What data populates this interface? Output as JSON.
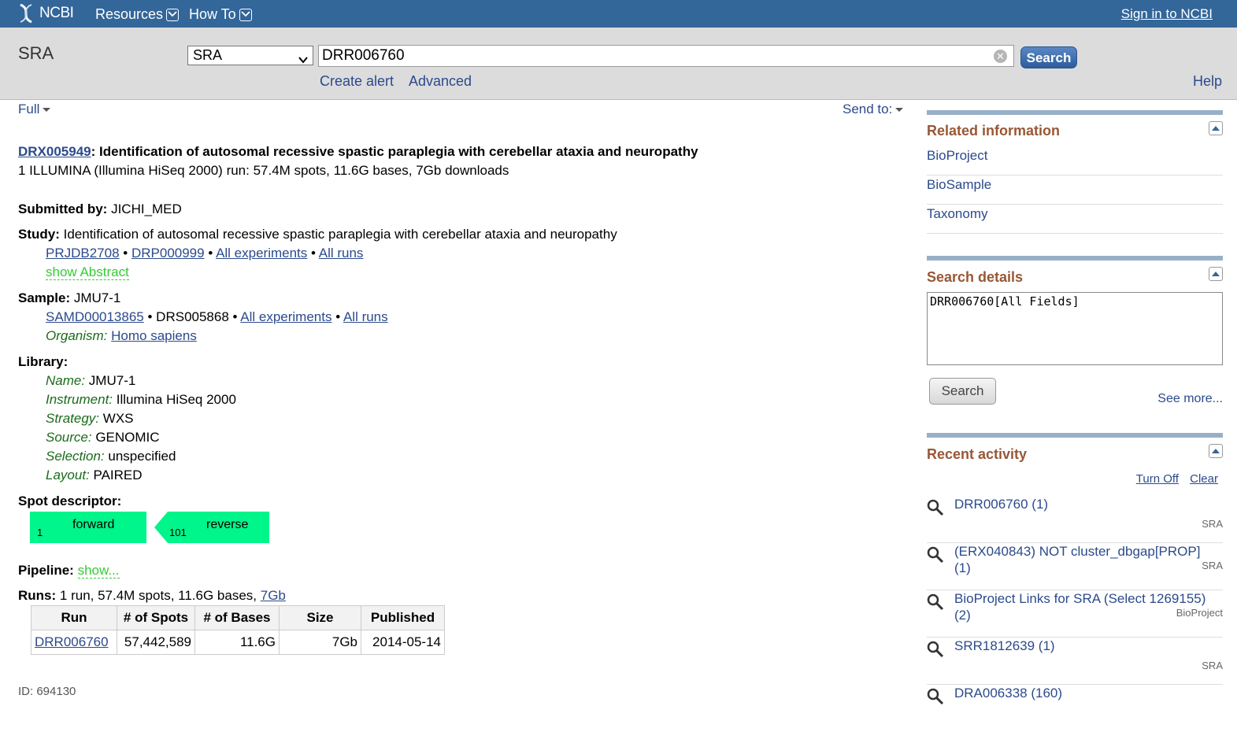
{
  "topbar": {
    "logo": "NCBI",
    "resources": "Resources",
    "howto": "How To",
    "signin": "Sign in to NCBI"
  },
  "search": {
    "db_title": "SRA",
    "db_selected": "SRA",
    "term": "DRR006760",
    "button": "Search",
    "create_alert": "Create alert",
    "advanced": "Advanced",
    "help": "Help"
  },
  "toolbar": {
    "full": "Full",
    "send_to": "Send to:"
  },
  "record": {
    "accession": "DRX005949",
    "title": ": Identification of autosomal recessive spastic paraplegia with cerebellar ataxia and neuropathy",
    "summary": "1 ILLUMINA (Illumina HiSeq 2000) run: 57.4M spots, 11.6G bases, 7Gb downloads",
    "submitted_label": "Submitted by:",
    "submitted_value": " JICHI_MED",
    "study_label": "Study:",
    "study_value": " Identification of autosomal recessive spastic paraplegia with cerebellar ataxia and neuropathy",
    "study_links": [
      "PRJDB2708",
      "DRP000999",
      "All experiments",
      "All runs"
    ],
    "sep": " • ",
    "show_abstract": "show Abstract",
    "sample_label": "Sample:",
    "sample_value": " JMU7-1",
    "sample_link1": "SAMD00013865",
    "sample_mid": "DRS005868",
    "sample_link2": "All experiments",
    "sample_link3": "All runs",
    "organism_label": "Organism:",
    "organism_value": "Homo sapiens",
    "library_label": "Library:",
    "library": [
      {
        "label": "Name:",
        "value": " JMU7-1"
      },
      {
        "label": "Instrument:",
        "value": " Illumina HiSeq 2000"
      },
      {
        "label": "Strategy:",
        "value": " WXS"
      },
      {
        "label": "Source:",
        "value": " GENOMIC"
      },
      {
        "label": "Selection:",
        "value": " unspecified"
      },
      {
        "label": "Layout:",
        "value": " PAIRED"
      }
    ],
    "spot_label": "Spot descriptor:",
    "spot_forward": "forward",
    "spot_forward_pos": "1",
    "spot_reverse": "reverse",
    "spot_reverse_pos": "101",
    "pipeline_label": "Pipeline:",
    "pipeline_link": "show...",
    "runs_label": "Runs:",
    "runs_value": " 1 run, 57.4M spots, 11.6G bases, ",
    "runs_link": "7Gb",
    "table_headers": [
      "Run",
      "# of Spots",
      "# of Bases",
      "Size",
      "Published"
    ],
    "table_row": [
      "DRR006760",
      "57,442,589",
      "11.6G",
      "7Gb",
      "2014-05-14"
    ],
    "id_text": "ID: 694130"
  },
  "sidebar": {
    "related_title": "Related information",
    "related_items": [
      "BioProject",
      "BioSample",
      "Taxonomy"
    ],
    "search_details_title": "Search details",
    "query": "DRR006760[All Fields]",
    "search_button": "Search",
    "see_more": "See more...",
    "recent_title": "Recent activity",
    "turn_off": "Turn Off",
    "clear": "Clear",
    "recent_items": [
      {
        "text": "DRR006760 (1)",
        "db": "SRA"
      },
      {
        "text": "(ERX040843) NOT cluster_dbgap[PROP] (1)",
        "db": "SRA"
      },
      {
        "text": "BioProject Links for SRA (Select 1269155) (2)",
        "db": "BioProject"
      },
      {
        "text": "SRR1812639 (1)",
        "db": "SRA"
      },
      {
        "text": "DRA006338 (160)",
        "db": ""
      }
    ]
  },
  "colors": {
    "topbar": "#336699",
    "searchbar": "#dcdcdc",
    "link": "#2b4a8c",
    "sidebar_heading": "#985735",
    "spot": "#00f58a"
  }
}
